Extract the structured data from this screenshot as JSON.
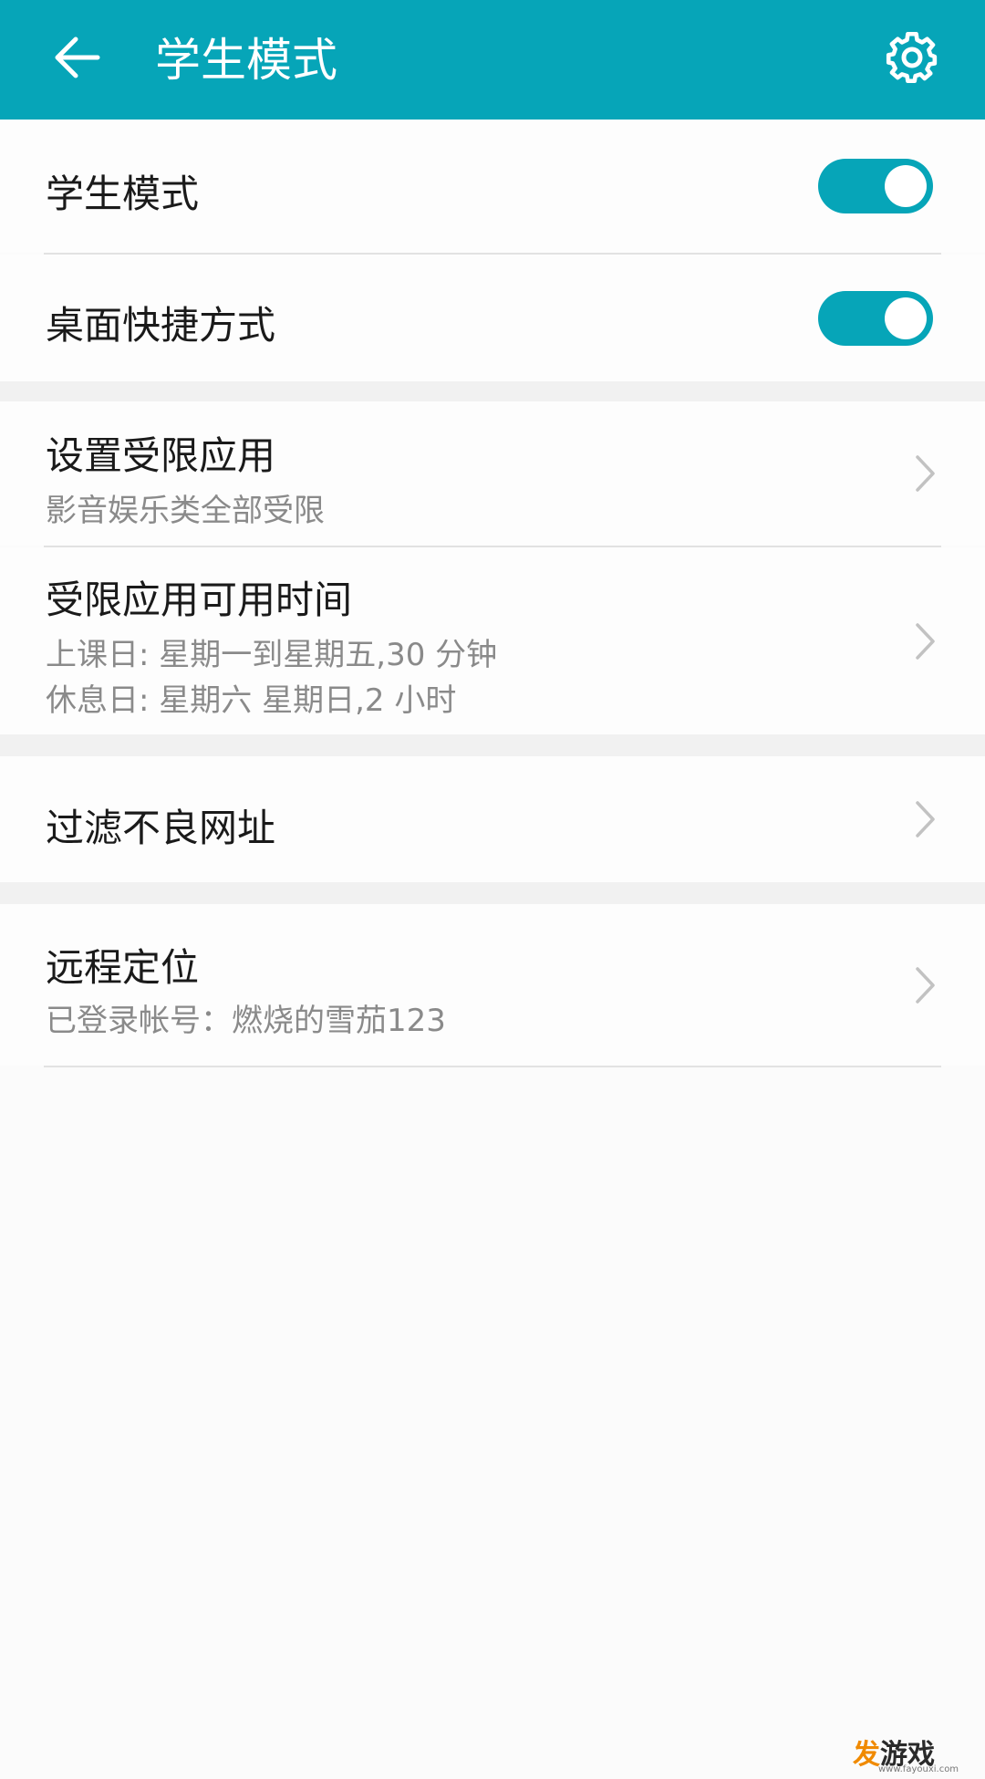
{
  "header": {
    "title": "学生模式",
    "back_icon": "arrow-left-icon",
    "settings_icon": "gear-icon"
  },
  "colors": {
    "accent": "#06a5b8",
    "background": "#fbfbfb",
    "section_gap": "#f1f1f1",
    "primary_text": "#1a1a1a",
    "secondary_text": "#8a8a8a"
  },
  "toggles": {
    "student_mode": {
      "label": "学生模式",
      "on": true
    },
    "desktop_shortcut": {
      "label": "桌面快捷方式",
      "on": true
    }
  },
  "restricted_apps": {
    "title": "设置受限应用",
    "subtitle": "影音娱乐类全部受限"
  },
  "usage_time": {
    "title": "受限应用可用时间",
    "school_days": "上课日: 星期一到星期五,30 分钟",
    "rest_days": "休息日: 星期六 星期日,2 小时"
  },
  "filter": {
    "title": "过滤不良网址"
  },
  "remote_location": {
    "title": "远程定位",
    "subtitle": "已登录帐号：燃烧的雪茄123"
  },
  "watermark": {
    "main_first": "发",
    "main_rest": "游戏",
    "sub": "www.fayouxi.com"
  }
}
